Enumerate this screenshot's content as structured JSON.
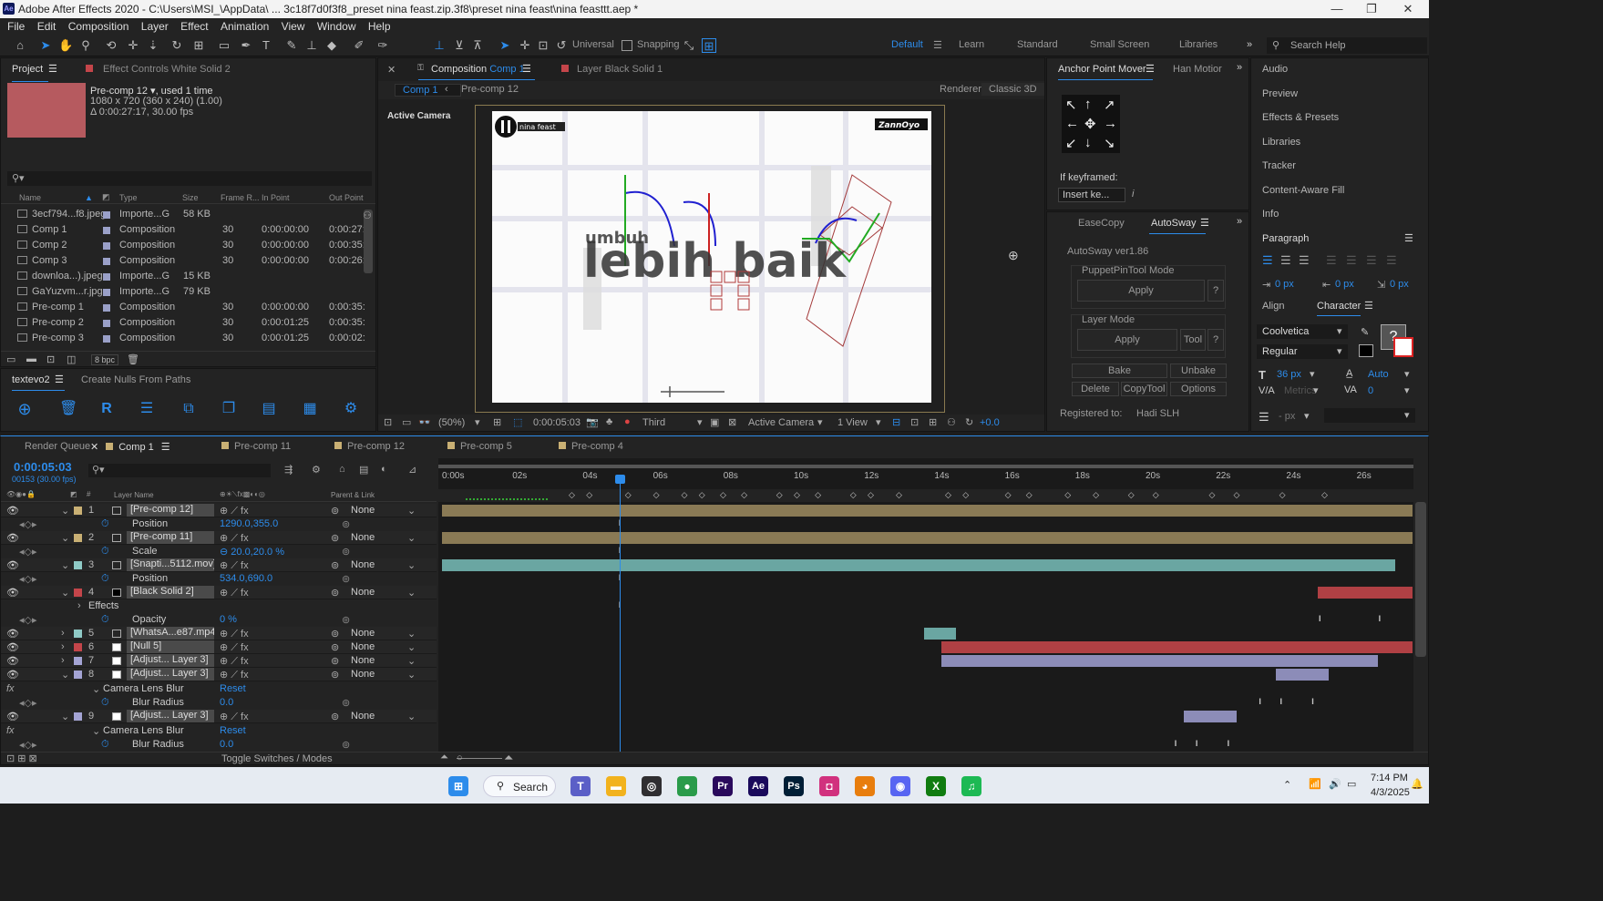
{
  "window": {
    "title": "Adobe After Effects 2020 - C:\\Users\\MSI_\\AppData\\ ... 3c18f7d0f3f8_preset nina feast.zip.3f8\\preset nina feast\\nina feasttt.aep *",
    "app_badge": "Ae",
    "minimize": "—",
    "maximize": "❐",
    "close": "✕"
  },
  "menu": [
    "File",
    "Edit",
    "Composition",
    "Layer",
    "Effect",
    "Animation",
    "View",
    "Window",
    "Help"
  ],
  "toolbar": {
    "universal": "Universal",
    "snapping": "Snapping",
    "workspaces": [
      "Default",
      "Learn",
      "Standard",
      "Small Screen",
      "Libraries"
    ],
    "more": "»",
    "search_placeholder": "Search Help"
  },
  "project": {
    "tab": "Project",
    "menu": "☰",
    "effect_controls": "Effect Controls White Solid 2",
    "selected_name": "Pre-comp 12",
    "selected_used": ", used 1 time",
    "selected_dims": "1080 x 720  (360 x 240) (1.00)",
    "selected_dur": "Δ 0:00:27:17, 30.00 fps",
    "search_glyph": "⚲▾",
    "headers": [
      "Name",
      "Type",
      "Size",
      "Frame R...",
      "In Point",
      "Out Point"
    ],
    "items": [
      {
        "name": "3ecf794...f8.jpeg",
        "type": "Importe...G",
        "size": "58 KB",
        "fr": "",
        "in": "",
        "out": ""
      },
      {
        "name": "Comp 1",
        "type": "Composition",
        "size": "",
        "fr": "30",
        "in": "0:00:00:00",
        "out": "0:00:27:"
      },
      {
        "name": "Comp 2",
        "type": "Composition",
        "size": "",
        "fr": "30",
        "in": "0:00:00:00",
        "out": "0:00:35:"
      },
      {
        "name": "Comp 3",
        "type": "Composition",
        "size": "",
        "fr": "30",
        "in": "0:00:00:00",
        "out": "0:00:26:"
      },
      {
        "name": "downloa...).jpeg",
        "type": "Importe...G",
        "size": "15 KB",
        "fr": "",
        "in": "",
        "out": ""
      },
      {
        "name": "GaYuzvm...r.jpg",
        "type": "Importe...G",
        "size": "79 KB",
        "fr": "",
        "in": "",
        "out": ""
      },
      {
        "name": "Pre-comp 1",
        "type": "Composition",
        "size": "",
        "fr": "30",
        "in": "0:00:00:00",
        "out": "0:00:35:"
      },
      {
        "name": "Pre-comp 2",
        "type": "Composition",
        "size": "",
        "fr": "30",
        "in": "0:00:01:25",
        "out": "0:00:35:"
      },
      {
        "name": "Pre-comp 3",
        "type": "Composition",
        "size": "",
        "fr": "30",
        "in": "0:00:01:25",
        "out": "0:00:02:"
      }
    ],
    "bpc": "8 bpc",
    "footer_icons": [
      "interpret-icon",
      "folder-icon",
      "new-comp-icon",
      "settings-icon",
      "trash-icon"
    ]
  },
  "textevo": {
    "tab": "textevo2",
    "menu": "☰",
    "other_tab": "Create Nulls From Paths",
    "icons": [
      "add-icon",
      "delete-icon",
      "text-icon",
      "list-icon",
      "shapes-icon",
      "copy-icon",
      "paste-icon",
      "grid-icon",
      "gear-icon"
    ]
  },
  "comp": {
    "tab_close": "✕",
    "lock": "🔒",
    "tab_label": "Composition",
    "tab_name": "Comp 1",
    "tab_menu": "☰",
    "layer_tab": "Layer Black Solid 1",
    "nav": [
      "Comp 1",
      "Pre-comp 12"
    ],
    "nav_arrow": "‹",
    "renderer_label": "Renderer:",
    "renderer": "Classic 3D",
    "active_camera": "Active Camera",
    "canvas_text_main": "lebih baik",
    "canvas_text_top": "umbuh",
    "canvas_logo_left": "nina feast",
    "canvas_logo_right": "ZannOyo",
    "bottom": {
      "zoom": "(50%)",
      "timecode": "0:00:05:03",
      "view": "Third",
      "camera": "Active Camera",
      "views": "1 View",
      "offset": "+0.0"
    }
  },
  "anchor": {
    "tab": "Anchor Point Mover",
    "menu": "☰",
    "other": "Han Motior",
    "more": "»",
    "arrows": [
      "↖",
      "↑",
      "↗",
      "←",
      "✥",
      "→",
      "↙",
      "↓",
      "↘"
    ],
    "if_keyframed": "If keyframed:",
    "insert": "Insert ke...",
    "info": "i"
  },
  "autosway": {
    "tabs": [
      "EaseCopy",
      "AutoSway"
    ],
    "menu": "☰",
    "more": "»",
    "version": "AutoSway ver1.86",
    "puppet_mode": "PuppetPinTool Mode",
    "apply": "Apply",
    "help": "?",
    "layer_mode": "Layer Mode",
    "tool": "Tool",
    "buttons": [
      "Bake",
      "Unbake",
      "Delete",
      "CopyTool",
      "Options"
    ],
    "registered_label": "Registered to:",
    "registered_name": "Hadi SLH"
  },
  "right": {
    "items": [
      "Audio",
      "Preview",
      "Effects & Presets",
      "Libraries",
      "Tracker",
      "Content-Aware Fill",
      "Info"
    ],
    "paragraph": "Paragraph",
    "para_values": [
      "0 px",
      "0 px",
      "0 px"
    ],
    "align": "Align",
    "character": "Character",
    "font": "Coolvetica",
    "style": "Regular",
    "size": "36 px",
    "leading": "Auto",
    "kerning": "Metrics",
    "tracking": "0",
    "px_field": "- px",
    "help": "?"
  },
  "timeline": {
    "tabs": [
      {
        "label": "Render Queue",
        "color": ""
      },
      {
        "label": "Comp 1",
        "color": "#c9b074"
      },
      {
        "label": "Pre-comp 11",
        "color": "#c9b074"
      },
      {
        "label": "Pre-comp 12",
        "color": "#c9b074"
      },
      {
        "label": "Pre-comp 5",
        "color": "#c9b074"
      },
      {
        "label": "Pre-comp 4",
        "color": "#c9b074"
      }
    ],
    "tab_close": "✕",
    "menu": "☰",
    "timecode": "0:00:05:03",
    "frames": "00153 (30.00 fps)",
    "col_layer": "Layer Name",
    "col_parent": "Parent & Link",
    "ruler": [
      "0:00s",
      "02s",
      "04s",
      "06s",
      "08s",
      "10s",
      "12s",
      "14s",
      "16s",
      "18s",
      "20s",
      "22s",
      "24s",
      "26s"
    ],
    "rows": [
      {
        "type": "layer",
        "num": "1",
        "name": "[Pre-comp 12]",
        "parent": "None",
        "color": "#c9b074"
      },
      {
        "type": "prop",
        "name": "Position",
        "value": "1290.0,355.0"
      },
      {
        "type": "layer",
        "num": "2",
        "name": "[Pre-comp 11]",
        "parent": "None",
        "color": "#c9b074"
      },
      {
        "type": "prop",
        "name": "Scale",
        "value": "⊖ 20.0,20.0 %"
      },
      {
        "type": "layer",
        "num": "3",
        "name": "[Snapti...5112.mov]",
        "parent": "None",
        "color": "#8fcac6"
      },
      {
        "type": "prop",
        "name": "Position",
        "value": "534.0,690.0"
      },
      {
        "type": "layer",
        "num": "4",
        "name": "[Black Solid 2]",
        "parent": "None",
        "color": "#c4454a"
      },
      {
        "type": "group",
        "name": "Effects",
        "value": ""
      },
      {
        "type": "prop",
        "name": "Opacity",
        "value": "0 %"
      },
      {
        "type": "layer",
        "num": "5",
        "name": "[WhatsA...e87.mp4]",
        "parent": "None",
        "color": "#8fcac6"
      },
      {
        "type": "layer",
        "num": "6",
        "name": "[Null 5]",
        "parent": "None",
        "color": "#c4454a"
      },
      {
        "type": "layer",
        "num": "7",
        "name": "[Adjust... Layer 3]",
        "parent": "None",
        "color": "#a4a4d4"
      },
      {
        "type": "layer",
        "num": "8",
        "name": "[Adjust... Layer 3]",
        "parent": "None",
        "color": "#a4a4d4"
      },
      {
        "type": "effect",
        "name": "Camera Lens Blur",
        "value": "Reset"
      },
      {
        "type": "prop",
        "name": "Blur Radius",
        "value": "0.0"
      },
      {
        "type": "layer",
        "num": "9",
        "name": "[Adjust... Layer 3]",
        "parent": "None",
        "color": "#a4a4d4"
      },
      {
        "type": "effect",
        "name": "Camera Lens Blur",
        "value": "Reset"
      },
      {
        "type": "prop",
        "name": "Blur Radius",
        "value": "0.0"
      }
    ],
    "toggle": "Toggle Switches / Modes"
  },
  "taskbar": {
    "search": "Search",
    "time": "7:14 PM",
    "date": "4/3/2025",
    "apps": [
      "windows-start",
      "teams",
      "file-explorer",
      "obs",
      "chrome",
      "premiere-pro",
      "after-effects",
      "photoshop",
      "instagram",
      "blender",
      "discord",
      "xbox",
      "spotify"
    ],
    "app_labels": [
      "",
      "T",
      "▬",
      "◎",
      "●",
      "Pr",
      "Ae",
      "Ps",
      "◘",
      "◕",
      "◉",
      "X",
      "♫"
    ],
    "colors": {
      "teams": "#5b5fc7",
      "explorer": "#f2b21d",
      "obs": "#302e31",
      "chrome": "#2a9b4a",
      "premiere": "#2a0a5c",
      "ae": "#1a0a5c",
      "ps": "#001e36",
      "instagram": "#d1317e",
      "blender": "#e87d0d",
      "discord": "#5865f2",
      "xbox": "#107c10",
      "spotify": "#1db954"
    }
  }
}
